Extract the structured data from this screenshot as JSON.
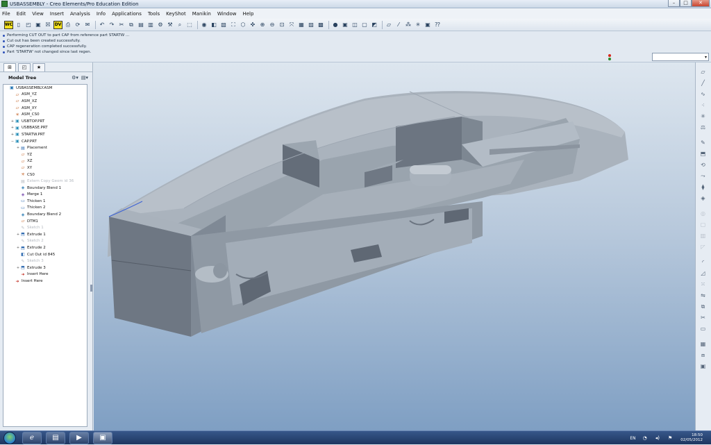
{
  "window": {
    "title": "USBASSEMBLY - Creo Elements/Pro Education Edition",
    "min": "–",
    "max": "□",
    "close": "✕"
  },
  "menu": [
    "File",
    "Edit",
    "View",
    "Insert",
    "Analysis",
    "Info",
    "Applications",
    "Tools",
    "KeyShot",
    "Manikin",
    "Window",
    "Help"
  ],
  "toolbar": {
    "wc_label": "WC",
    "dv_label": "DV"
  },
  "messages": [
    "Performing CUT OUT to part CAP from reference part STARTW ...",
    "Cut out has been created successfully.",
    "CAP regeneration completed successfully.",
    "Part 'STARTW' not changed since last regen."
  ],
  "filter": {
    "value": ""
  },
  "left_panel": {
    "title": "Model Tree",
    "tool1": "⚙▾",
    "tool2": "▤▾"
  },
  "tree": [
    {
      "label": "USBASSEMBLY.ASM",
      "exp": "",
      "icon": "▣",
      "indent": 0,
      "dim": false,
      "color": "#1a6fb0"
    },
    {
      "label": "ASM_YZ",
      "exp": "",
      "icon": "▱",
      "indent": 1,
      "dim": false,
      "color": "#c05a1b"
    },
    {
      "label": "ASM_XZ",
      "exp": "",
      "icon": "▱",
      "indent": 1,
      "dim": false,
      "color": "#c05a1b"
    },
    {
      "label": "ASM_XY",
      "exp": "",
      "icon": "▱",
      "indent": 1,
      "dim": false,
      "color": "#c05a1b"
    },
    {
      "label": "ASM_CS0",
      "exp": "",
      "icon": "✳",
      "indent": 1,
      "dim": false,
      "color": "#c05a1b"
    },
    {
      "label": "USBTOP.PRT",
      "exp": "+",
      "icon": "▣",
      "indent": 1,
      "dim": false,
      "color": "#2a8fb8"
    },
    {
      "label": "USBBASE.PRT",
      "exp": "+",
      "icon": "▣",
      "indent": 1,
      "dim": false,
      "color": "#2a8fb8"
    },
    {
      "label": "STARTW.PRT",
      "exp": "+",
      "icon": "▣",
      "indent": 1,
      "dim": false,
      "color": "#2a8fb8"
    },
    {
      "label": "CAP.PRT",
      "exp": "−",
      "icon": "▣",
      "indent": 1,
      "dim": false,
      "color": "#2a8fb8"
    },
    {
      "label": "Placement",
      "exp": "+",
      "icon": "▤",
      "indent": 2,
      "dim": false,
      "color": "#2e6ab0"
    },
    {
      "label": "YZ",
      "exp": "",
      "icon": "▱",
      "indent": 2,
      "dim": false,
      "color": "#c05a1b"
    },
    {
      "label": "XZ",
      "exp": "",
      "icon": "▱",
      "indent": 2,
      "dim": false,
      "color": "#c05a1b"
    },
    {
      "label": "XY",
      "exp": "",
      "icon": "▱",
      "indent": 2,
      "dim": false,
      "color": "#c05a1b"
    },
    {
      "label": "CS0",
      "exp": "",
      "icon": "✳",
      "indent": 2,
      "dim": false,
      "color": "#c05a1b"
    },
    {
      "label": "Extern Copy Geom id 36",
      "exp": "",
      "icon": "▤",
      "indent": 2,
      "dim": true,
      "color": "#b3b8bf"
    },
    {
      "label": "Boundary Blend 1",
      "exp": "",
      "icon": "◈",
      "indent": 2,
      "dim": false,
      "color": "#2c7cb4"
    },
    {
      "label": "Merge 1",
      "exp": "",
      "icon": "◈",
      "indent": 2,
      "dim": false,
      "color": "#7b4fb0"
    },
    {
      "label": "Thicken 1",
      "exp": "",
      "icon": "▭",
      "indent": 2,
      "dim": false,
      "color": "#2e6ab0"
    },
    {
      "label": "Thicken 2",
      "exp": "",
      "icon": "▭",
      "indent": 2,
      "dim": false,
      "color": "#2e6ab0"
    },
    {
      "label": "Boundary Blend 2",
      "exp": "",
      "icon": "◈",
      "indent": 2,
      "dim": false,
      "color": "#2c7cb4"
    },
    {
      "label": "DTM1",
      "exp": "",
      "icon": "▱",
      "indent": 2,
      "dim": false,
      "color": "#c05a1b"
    },
    {
      "label": "Sketch 1",
      "exp": "",
      "icon": "✎",
      "indent": 2,
      "dim": true,
      "color": "#b3b8bf"
    },
    {
      "label": "Extrude 1",
      "exp": "+",
      "icon": "⬒",
      "indent": 2,
      "dim": false,
      "color": "#2e6ab0"
    },
    {
      "label": "Sketch 2",
      "exp": "",
      "icon": "✎",
      "indent": 2,
      "dim": true,
      "color": "#b3b8bf"
    },
    {
      "label": "Extrude 2",
      "exp": "+",
      "icon": "⬒",
      "indent": 2,
      "dim": false,
      "color": "#2e6ab0"
    },
    {
      "label": "Cut Out id 845",
      "exp": "",
      "icon": "◧",
      "indent": 2,
      "dim": false,
      "color": "#2e6ab0"
    },
    {
      "label": "Sketch 3",
      "exp": "",
      "icon": "✎",
      "indent": 2,
      "dim": true,
      "color": "#b3b8bf"
    },
    {
      "label": "Extrude 3",
      "exp": "+",
      "icon": "⬒",
      "indent": 2,
      "dim": false,
      "color": "#2e6ab0"
    },
    {
      "label": "Insert Here",
      "exp": "",
      "icon": "➜",
      "indent": 2,
      "dim": false,
      "color": "#c0261b"
    },
    {
      "label": "Insert Here",
      "exp": "",
      "icon": "➜",
      "indent": 1,
      "dim": false,
      "color": "#c0261b"
    }
  ],
  "taskbar": {
    "lang": "EN",
    "time": "18:50",
    "date": "02/05/2012"
  },
  "colors": {
    "model_light": "#b9c2cc",
    "model_mid": "#a3adb8",
    "model_dark": "#6f7884",
    "viewport_bottom": "#7f9fc3"
  }
}
